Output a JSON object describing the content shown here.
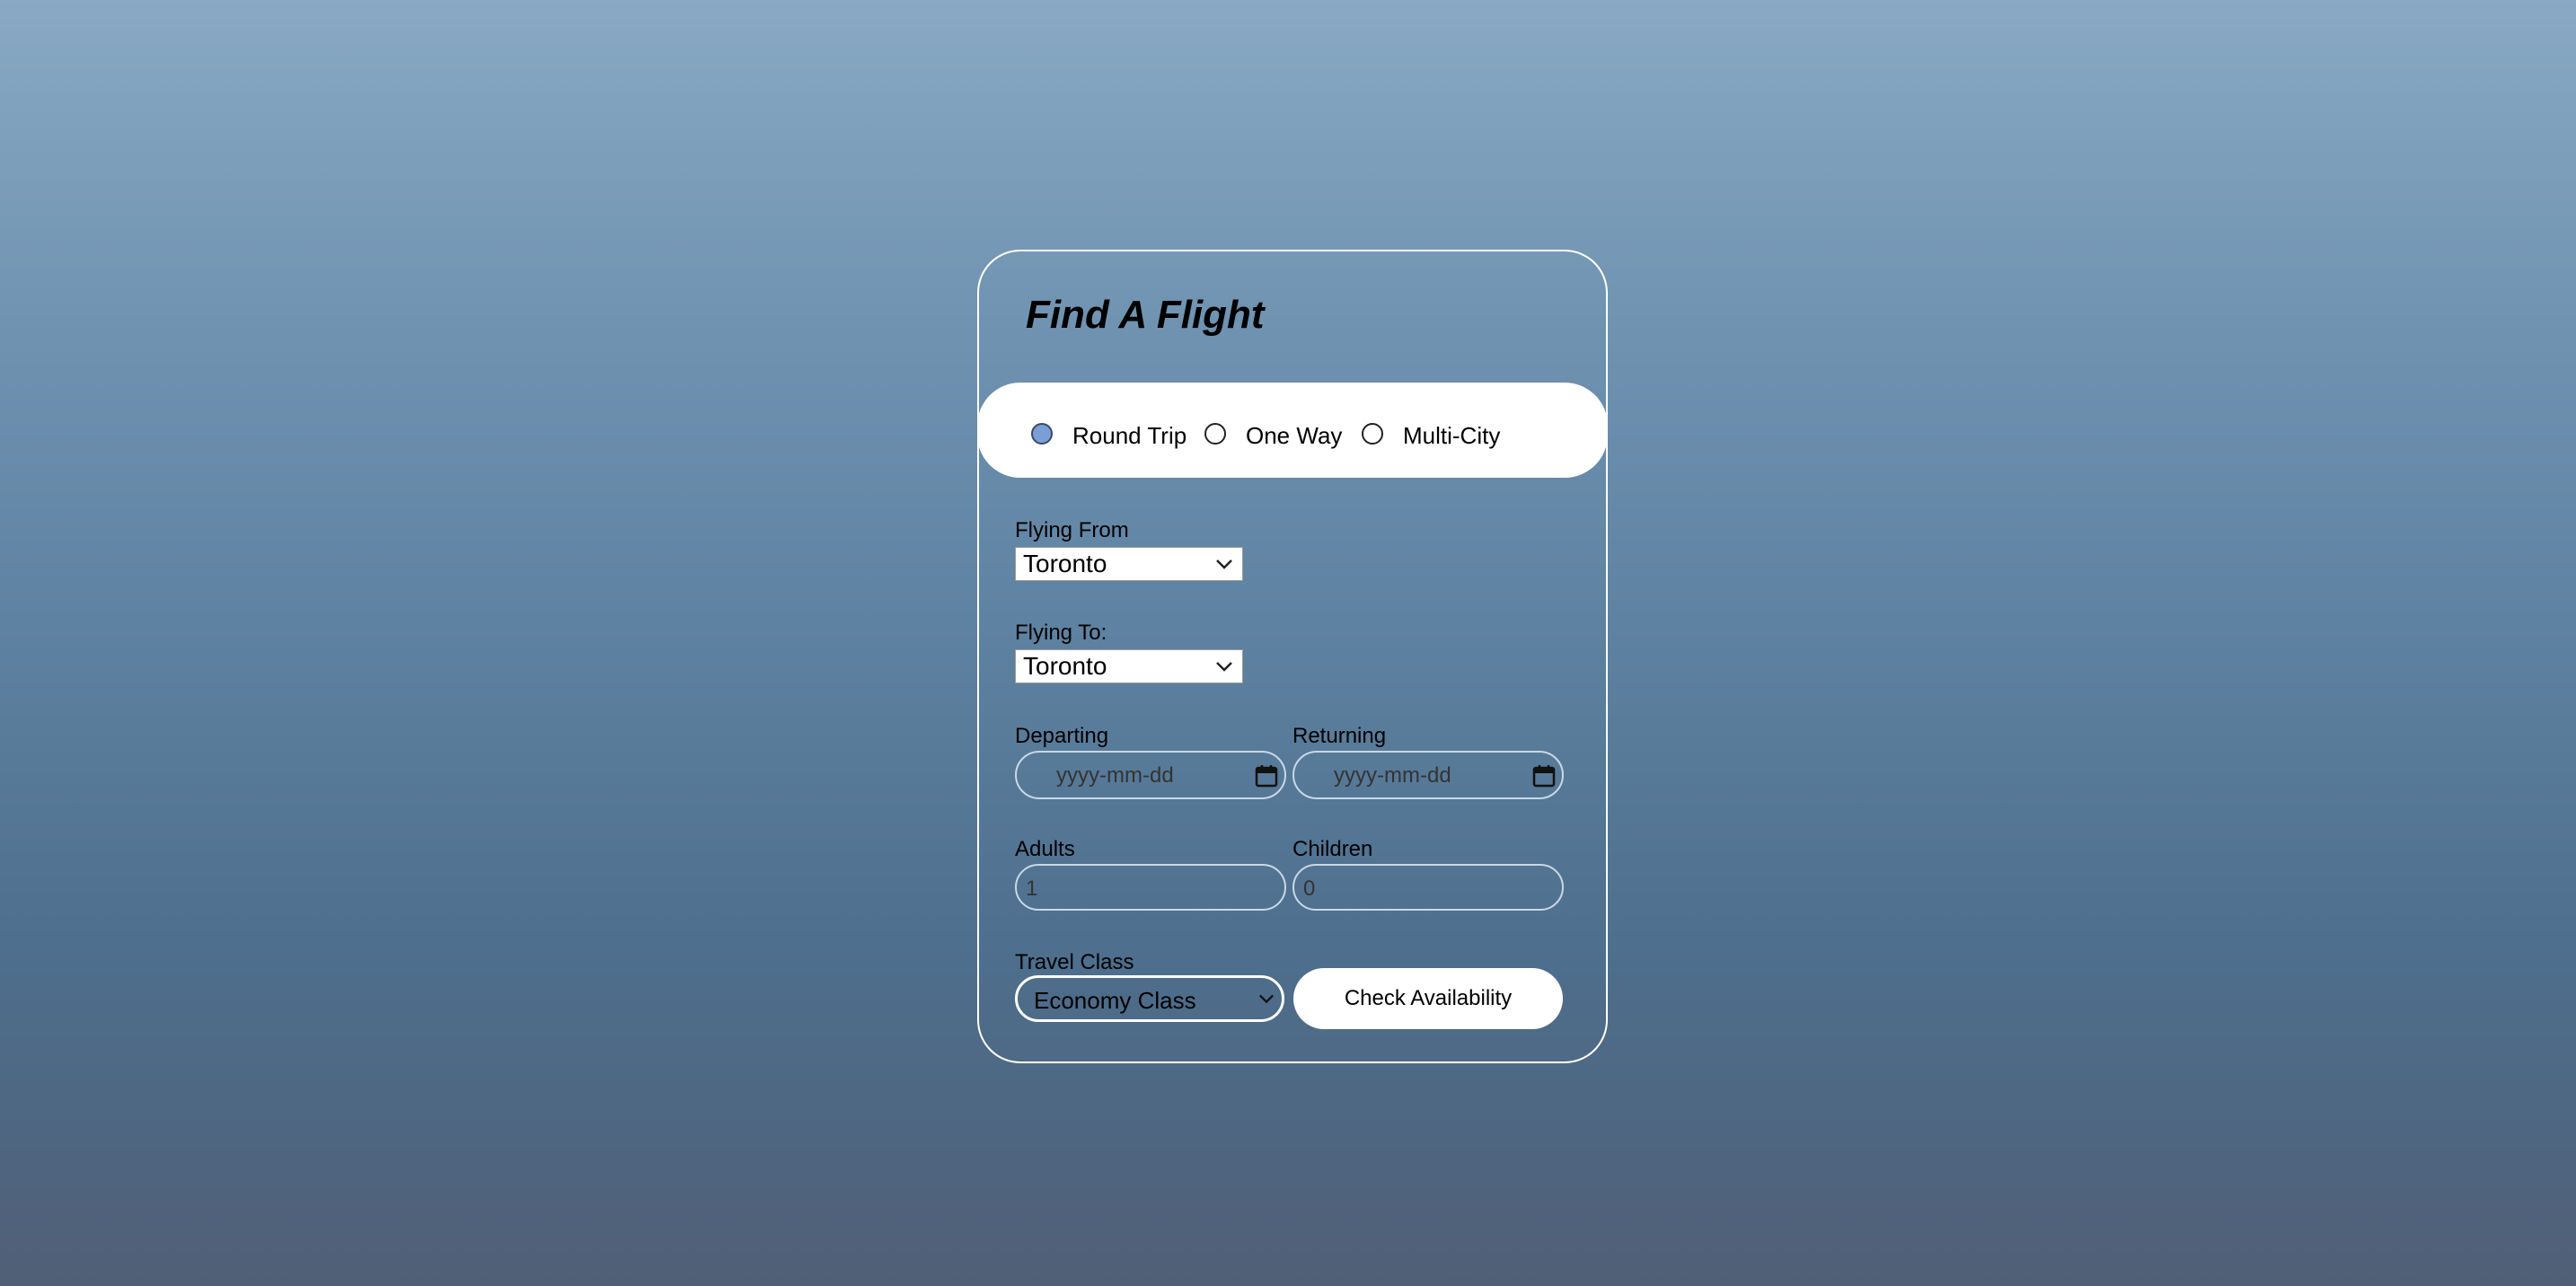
{
  "form": {
    "title": "Find A Flight",
    "trip_types": [
      {
        "label": "Round Trip",
        "selected": true
      },
      {
        "label": "One Way",
        "selected": false
      },
      {
        "label": "Multi-City",
        "selected": false
      }
    ],
    "flying_from": {
      "label": "Flying From",
      "value": "Toronto"
    },
    "flying_to": {
      "label": "Flying To:",
      "value": "Toronto"
    },
    "departing": {
      "label": "Departing",
      "placeholder": "yyyy-mm-dd"
    },
    "returning": {
      "label": "Returning",
      "placeholder": "yyyy-mm-dd"
    },
    "adults": {
      "label": "Adults",
      "value": "1"
    },
    "children": {
      "label": "Children",
      "value": "0"
    },
    "travel_class": {
      "label": "Travel Class",
      "value": "Economy Class"
    },
    "submit_label": "Check Availability"
  },
  "icons": {
    "select_arrow": "chevron-down-icon",
    "date_picker": "calendar-icon"
  },
  "colors": {
    "selected_radio": "#7a9fd6",
    "card_border": "#ffffff",
    "button_bg": "#ffffff"
  }
}
